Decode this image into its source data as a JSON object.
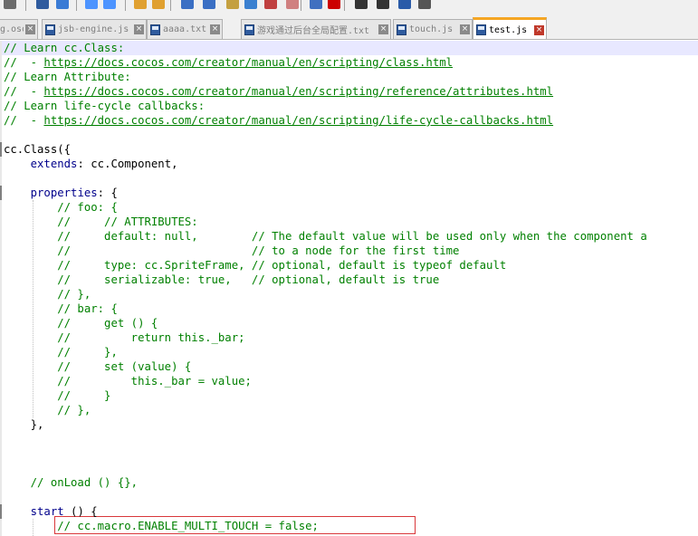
{
  "toolbar": {
    "buttons": [
      "undo-icon",
      "find-icon",
      "replace-icon",
      "zoom-in-icon",
      "zoom-out-icon",
      "sync-scroll-v-icon",
      "sync-scroll-h-icon",
      "word-wrap-icon",
      "show-all-chars-icon",
      "indent-guide-icon",
      "doc-map-icon",
      "function-list-icon",
      "folder-as-workspace-icon",
      "monitor-icon",
      "record-macro-icon",
      "stop-record-icon",
      "play-macro-icon",
      "run-macro-multiple-icon",
      "save-macro-icon"
    ]
  },
  "tabs": [
    {
      "label": "g.osd",
      "active": false
    },
    {
      "label": "jsb-engine.js",
      "active": false
    },
    {
      "label": "aaaa.txt",
      "active": false
    },
    {
      "label": "游戏通过后台全局配置.txt",
      "active": false
    },
    {
      "label": "touch.js",
      "active": false
    },
    {
      "label": "test.js",
      "active": true
    }
  ],
  "editor": {
    "lines": [
      [
        {
          "t": "// Learn cc.Class:",
          "c": "c"
        }
      ],
      [
        {
          "t": "//  - ",
          "c": "c"
        },
        {
          "t": "https://docs.cocos.com/creator/manual/en/scripting/class.html",
          "c": "u"
        }
      ],
      [
        {
          "t": "// Learn Attribute:",
          "c": "c"
        }
      ],
      [
        {
          "t": "//  - ",
          "c": "c"
        },
        {
          "t": "https://docs.cocos.com/creator/manual/en/scripting/reference/attributes.html",
          "c": "u"
        }
      ],
      [
        {
          "t": "// Learn life-cycle callbacks:",
          "c": "c"
        }
      ],
      [
        {
          "t": "//  - ",
          "c": "c"
        },
        {
          "t": "https://docs.cocos.com/creator/manual/en/scripting/life-cycle-callbacks.html",
          "c": "u"
        }
      ],
      [],
      [
        {
          "t": "cc.Class({",
          "c": ""
        }
      ],
      [
        {
          "t": "    ",
          "c": ""
        },
        {
          "t": "extends",
          "c": "k"
        },
        {
          "t": ": cc.Component,",
          "c": ""
        }
      ],
      [],
      [
        {
          "t": "    ",
          "c": ""
        },
        {
          "t": "properties",
          "c": "k"
        },
        {
          "t": ": {",
          "c": ""
        }
      ],
      [
        {
          "t": "        // foo: {",
          "c": "c"
        }
      ],
      [
        {
          "t": "        //     // ATTRIBUTES:",
          "c": "c"
        }
      ],
      [
        {
          "t": "        //     default: null,        // The default value will be used only when the component a",
          "c": "c"
        }
      ],
      [
        {
          "t": "        //                           // to a node for the first time",
          "c": "c"
        }
      ],
      [
        {
          "t": "        //     type: cc.SpriteFrame, // optional, default is typeof default",
          "c": "c"
        }
      ],
      [
        {
          "t": "        //     serializable: true,   // optional, default is true",
          "c": "c"
        }
      ],
      [
        {
          "t": "        // },",
          "c": "c"
        }
      ],
      [
        {
          "t": "        // bar: {",
          "c": "c"
        }
      ],
      [
        {
          "t": "        //     get () {",
          "c": "c"
        }
      ],
      [
        {
          "t": "        //         return this._bar;",
          "c": "c"
        }
      ],
      [
        {
          "t": "        //     },",
          "c": "c"
        }
      ],
      [
        {
          "t": "        //     set (value) {",
          "c": "c"
        }
      ],
      [
        {
          "t": "        //         this._bar = value;",
          "c": "c"
        }
      ],
      [
        {
          "t": "        //     }",
          "c": "c"
        }
      ],
      [
        {
          "t": "        // },",
          "c": "c"
        }
      ],
      [
        {
          "t": "    },",
          "c": ""
        }
      ],
      [],
      [],
      [],
      [
        {
          "t": "    // onLoad () {},",
          "c": "c"
        }
      ],
      [],
      [
        {
          "t": "    ",
          "c": ""
        },
        {
          "t": "start",
          "c": "k"
        },
        {
          "t": " () {",
          "c": ""
        }
      ],
      [
        {
          "t": "        // cc.macro.ENABLE_MULTI_TOUCH = false;",
          "c": "c"
        }
      ]
    ]
  }
}
